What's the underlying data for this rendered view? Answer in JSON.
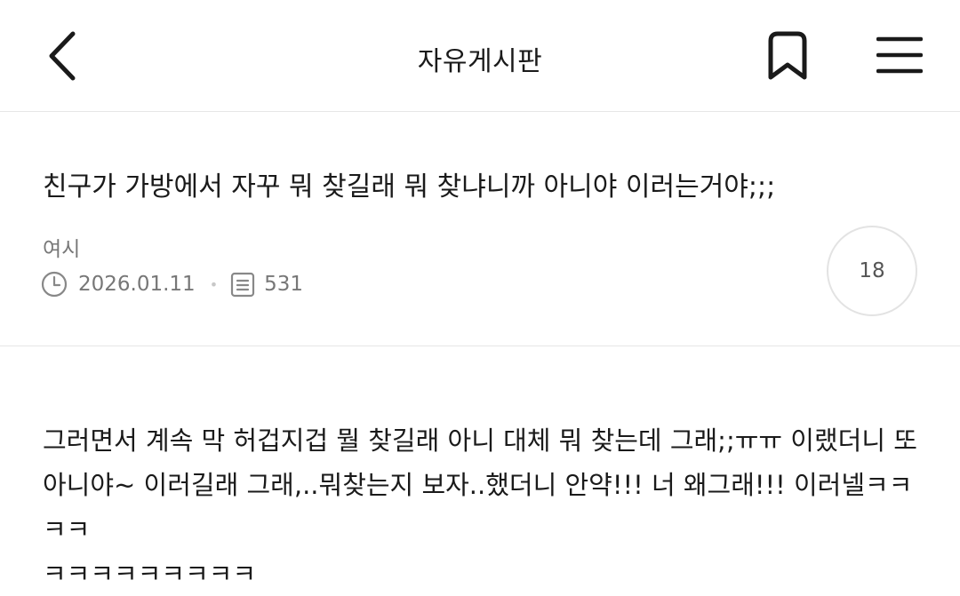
{
  "header": {
    "title": "자유게시판",
    "back_icon": "chevron-left-icon",
    "bookmark_icon": "bookmark-icon",
    "menu_icon": "hamburger-menu-icon"
  },
  "post": {
    "title": "친구가 가방에서 자꾸 뭐 찾길래 뭐 찾냐니까 아니야 이러는거야;;;",
    "author": "여시",
    "date": "2026.01.11",
    "views": "531",
    "comment_count": "18",
    "body_lines": [
      "그러면서 계속 막 허겁지겁 뭘 찾길래 아니 대체 뭐 찾는데 그래;;ㅠㅠ 이랬더니 또",
      "아니야~ 이러길래 그래,..뭐찾는지 보자..했더니 안약!!! 너 왜그래!!! 이러넬ㅋㅋㅋㅋ",
      "ㅋㅋㅋㅋㅋㅋㅋㅋㅋ"
    ]
  },
  "colors": {
    "text": "#1a1a1a",
    "meta": "#777777",
    "divider": "#e6e6e6"
  }
}
